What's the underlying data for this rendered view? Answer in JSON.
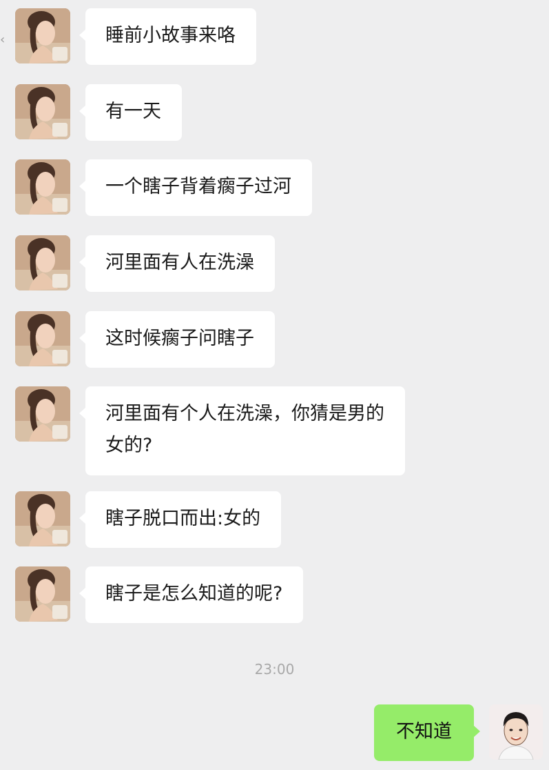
{
  "chat": {
    "incoming": [
      {
        "text": "睡前小故事来咯"
      },
      {
        "text": "有一天"
      },
      {
        "text": "一个瞎子背着瘸子过河"
      },
      {
        "text": "河里面有人在洗澡"
      },
      {
        "text": "这时候瘸子问瞎子"
      },
      {
        "text": "河里面有个人在洗澡，你猜是男的\n女的?"
      },
      {
        "text": "瞎子脱口而出:女的"
      },
      {
        "text": "瞎子是怎么知道的呢?"
      }
    ],
    "timestamp": "23:00",
    "outgoing": [
      {
        "text": "不知道"
      }
    ]
  },
  "colors": {
    "background": "#eeeeef",
    "incoming_bubble": "#ffffff",
    "outgoing_bubble": "#95ec69",
    "timestamp_text": "#a8a8a8"
  },
  "icons": {
    "back": "chevron-left-icon",
    "incoming_avatar": "girl-avatar-icon",
    "outgoing_avatar": "boy-avatar-icon"
  }
}
